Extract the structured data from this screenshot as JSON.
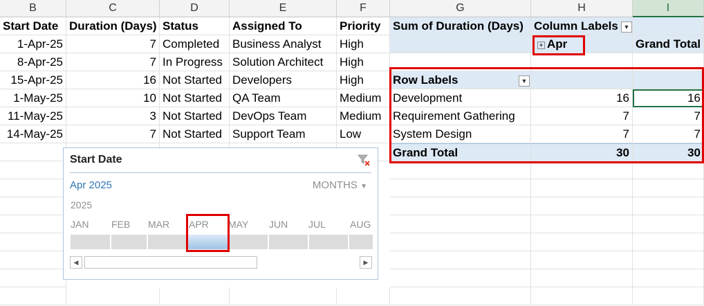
{
  "columns": {
    "B": "B",
    "C": "C",
    "D": "D",
    "E": "E",
    "F": "F",
    "G": "G",
    "H": "H",
    "I": "I"
  },
  "headers": [
    "Start Date",
    "Duration (Days)",
    "Status",
    "Assigned To",
    "Priority"
  ],
  "rows": [
    [
      "1-Apr-25",
      "7",
      "Completed",
      "Business Analyst",
      "High"
    ],
    [
      "8-Apr-25",
      "7",
      "In Progress",
      "Solution Architect",
      "High"
    ],
    [
      "15-Apr-25",
      "16",
      "Not Started",
      "Developers",
      "High"
    ],
    [
      "1-May-25",
      "10",
      "Not Started",
      "QA Team",
      "Medium"
    ],
    [
      "11-May-25",
      "3",
      "Not Started",
      "DevOps Team",
      "Medium"
    ],
    [
      "14-May-25",
      "7",
      "Not Started",
      "Support Team",
      "Low"
    ]
  ],
  "pivot": {
    "value_header": "Sum of Duration (Days)",
    "column_labels": "Column Labels",
    "column_item": "Apr",
    "grand_total": "Grand Total",
    "row_labels": "Row Labels",
    "rows": [
      {
        "label": "Development",
        "apr": "16",
        "total": "16"
      },
      {
        "label": "Requirement Gathering",
        "apr": "7",
        "total": "7"
      },
      {
        "label": "System Design",
        "apr": "7",
        "total": "7"
      }
    ],
    "grand_total_row": {
      "label": "Grand Total",
      "apr": "30",
      "total": "30"
    }
  },
  "slicer": {
    "title": "Start Date",
    "period": "Apr 2025",
    "level": "MONTHS",
    "year": "2025",
    "months": [
      "JAN",
      "FEB",
      "MAR",
      "APR",
      "MAY",
      "JUN",
      "JUL",
      "AUG"
    ],
    "selected_month": "APR"
  },
  "colors": {
    "highlight": "#e00000",
    "pivot_band": "#dde9f5",
    "accent": "#2e75b6"
  }
}
